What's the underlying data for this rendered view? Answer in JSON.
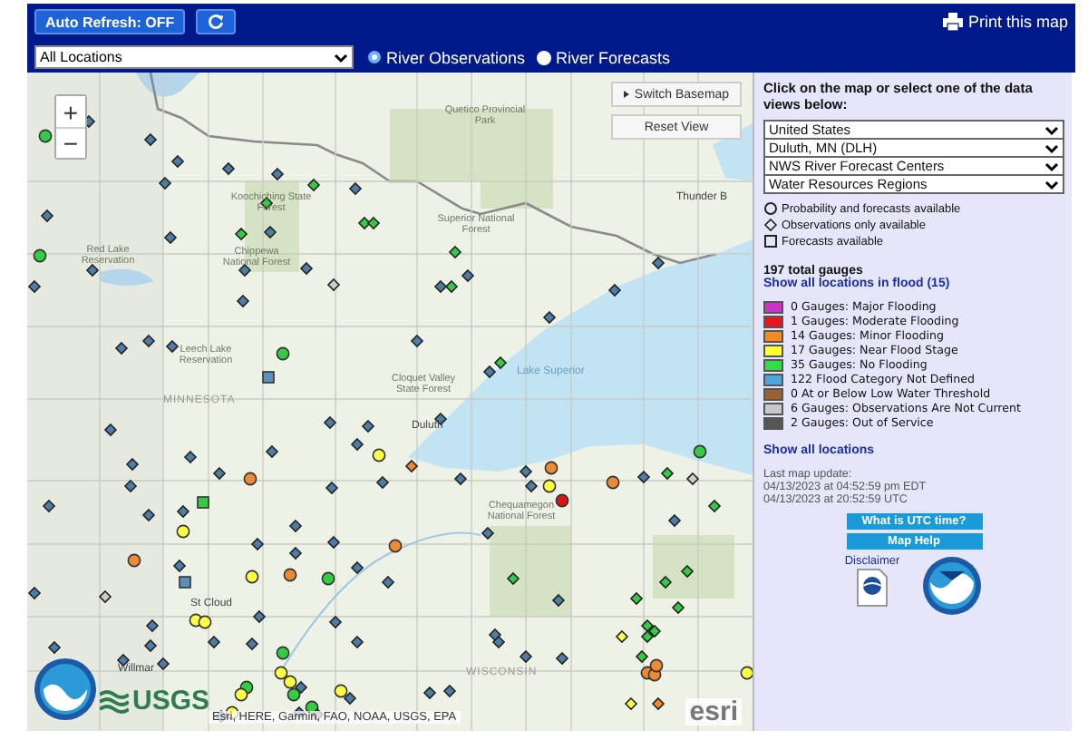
{
  "toolbar": {
    "auto_refresh": "Auto Refresh: OFF",
    "print_link": "Print this map"
  },
  "location_select": {
    "value": "All Locations"
  },
  "view_options": [
    {
      "label": "River Observations",
      "selected": true
    },
    {
      "label": "River Forecasts",
      "selected": false
    }
  ],
  "map": {
    "zoom_controls": [
      "+",
      "−"
    ],
    "buttons": [
      "Switch Basemap",
      "Reset View"
    ],
    "labels": [
      {
        "text": "Thunder B",
        "kind": "city"
      },
      {
        "text": "Quetico Provincial Park",
        "kind": "area"
      },
      {
        "text": "Superior National Forest",
        "kind": "area"
      },
      {
        "text": "Koochiching State Forest",
        "kind": "area"
      },
      {
        "text": "Red Lake Reservation",
        "kind": "area"
      },
      {
        "text": "Chippewa National Forest",
        "kind": "area"
      },
      {
        "text": "Leech Lake Reservation",
        "kind": "area"
      },
      {
        "text": "Cloquet Valley State Forest",
        "kind": "area"
      },
      {
        "text": "Lake Superior",
        "kind": "water"
      },
      {
        "text": "Duluth",
        "kind": "city"
      },
      {
        "text": "MINNESOTA",
        "kind": "state"
      },
      {
        "text": "St Cloud",
        "kind": "city"
      },
      {
        "text": "Willmar",
        "kind": "city"
      },
      {
        "text": "Chequamegon National Forest",
        "kind": "area"
      },
      {
        "text": "WISCONSIN",
        "kind": "state"
      }
    ],
    "logo_text": "USGS",
    "attribution": "Esri, HERE, Garmin, FAO, NOAA, USGS, EPA",
    "esri_text": "esri"
  },
  "sidebar": {
    "intro": "Click on the map or select one of the data views below:",
    "selects": [
      {
        "value": "United States"
      },
      {
        "value": "Duluth, MN (DLH)"
      },
      {
        "value": "NWS River Forecast Centers"
      },
      {
        "value": "Water Resources Regions"
      }
    ],
    "symbol_key": [
      {
        "kind": "circle",
        "label": "Probability and forecasts available"
      },
      {
        "kind": "diamond",
        "label": "Observations only available"
      },
      {
        "kind": "square",
        "label": "Forecasts available"
      }
    ],
    "total": "197 total gauges",
    "flood_link": "Show all locations in flood (15)",
    "legend": [
      {
        "label": "0 Gauges: Major Flooding",
        "color": "#cc33cc"
      },
      {
        "label": "1 Gauges: Moderate Flooding",
        "color": "#e8141e"
      },
      {
        "label": "14 Gauges: Minor Flooding",
        "color": "#f08c28"
      },
      {
        "label": "17 Gauges: Near Flood Stage",
        "color": "#ffff33"
      },
      {
        "label": "35 Gauges: No Flooding",
        "color": "#33dd44"
      },
      {
        "label": "122 Flood Category Not Defined",
        "color": "#4da6d9"
      },
      {
        "label": "0 At or Below Low Water Threshold",
        "color": "#9a6233"
      },
      {
        "label": "6 Gauges: Observations Are Not Current",
        "color": "#c8c8c8"
      },
      {
        "label": "2 Gauges: Out of Service",
        "color": "#555555"
      }
    ],
    "all_link": "Show all locations",
    "update": [
      "Last map update:",
      "04/13/2023 at 04:52:59 pm EDT",
      "04/13/2023 at 20:52:59 UTC"
    ],
    "buttons": [
      "What is UTC time?",
      "Map Help"
    ],
    "disclaimer": "Disclaimer"
  }
}
